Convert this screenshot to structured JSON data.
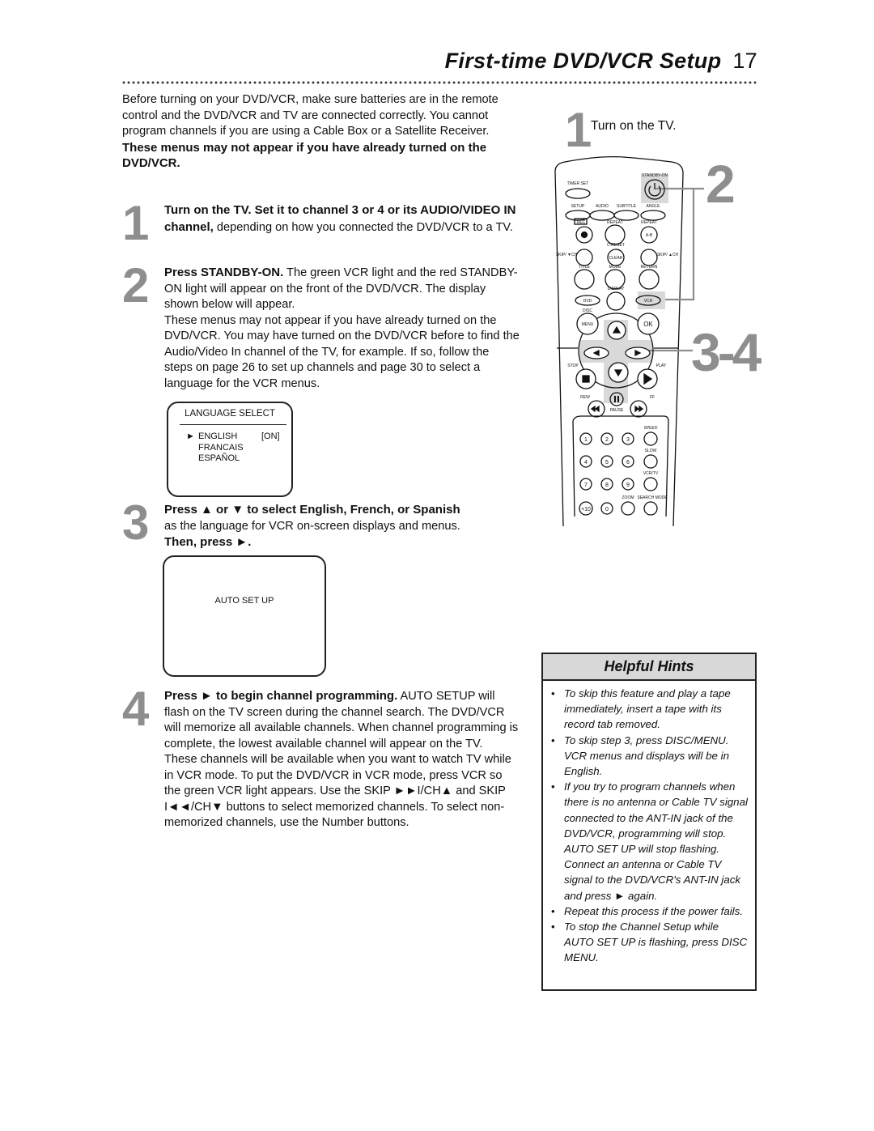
{
  "header": {
    "title": "First-time DVD/VCR Setup",
    "page_number": "17"
  },
  "intro": {
    "text": "Before turning on your DVD/VCR, make sure batteries are in the remote control and the DVD/VCR and TV are connected correctly. You cannot program channels if you are using a Cable Box or a Satellite Receiver.",
    "note": "These menus may not appear if you have already turned on the DVD/VCR."
  },
  "steps": [
    {
      "number": "1",
      "bold": "Turn on the TV. Set it to channel 3 or 4 or its AUDIO/VIDEO IN channel,",
      "text": " depending on how you connected the DVD/VCR to a TV."
    },
    {
      "number": "2",
      "bold": "Press STANDBY-ON.",
      "text": " The green VCR light and the red STANDBY-ON light will appear on the front of the DVD/VCR. The display shown below will appear.",
      "extra": "These menus may not appear if you have already turned on the DVD/VCR. You may have turned on the DVD/VCR before to find the Audio/Video In channel of the TV, for example. If so, follow the steps on page 26 to set up channels and page 30 to select a language for the VCR menus."
    },
    {
      "number": "3",
      "bold": "Press ▲ or ▼ to select English, French, or Spanish",
      "text": "as the language for VCR on-screen displays and menus.",
      "bold2": "Then, press ►."
    },
    {
      "number": "4",
      "bold": "Press ► to begin channel programming.",
      "text": " AUTO SETUP will flash on the TV screen during the channel search. The DVD/VCR will memorize all available channels. When channel programming is complete, the lowest available channel will appear on the TV.",
      "extra": "These channels will be available when you want to watch TV while in VCR mode. To put the DVD/VCR in VCR mode, press VCR so the green VCR light appears. Use the SKIP ►►I/CH▲ and SKIP I◄◄/CH▼ buttons to select memorized channels. To select non-memorized channels, use the Number buttons."
    }
  ],
  "language_screen": {
    "title": "LANGUAGE SELECT",
    "cursor": "►",
    "items": [
      "ENGLISH",
      "FRANCAIS",
      "ESPAÑOL"
    ],
    "selected_status": "[ON]"
  },
  "auto_screen": {
    "label": "AUTO SET UP"
  },
  "remote": {
    "step1_number": "1",
    "step1_label": "Turn on the TV.",
    "callout_2": "2",
    "callout_34": "3-4",
    "labels": {
      "standby": "STANDBY-ON",
      "timer_set": "TIMER SET",
      "setup": "SETUP",
      "audio": "AUDIO",
      "subtitle": "SUBTITLE",
      "angle": "ANGLE",
      "rec": "REC",
      "repeat": "REPEAT",
      "repeat_ab": "REPEAT",
      "ab": "A-B",
      "c_reset": "C-RESET",
      "clear": "CLEAR",
      "skip_left": "SKIP/ ▼CH",
      "skip_right": "SKIP/ ▲CH",
      "title": "TITLE",
      "mode": "MODE",
      "return": "RETURN",
      "display": "DISPLAY",
      "dvd": "DVD",
      "vcr": "VCR",
      "disc": "DISC",
      "menu": "MENU",
      "ok": "OK",
      "stop": "STOP",
      "play": "PLAY",
      "rew": "REW",
      "ff": "FF",
      "pause": "PAUSE",
      "speed": "SPEED",
      "slow": "SLOW",
      "vcr_tv": "VCR/TV",
      "zoom": "ZOOM",
      "search_mode": "SEARCH MODE"
    },
    "numbers": [
      "1",
      "2",
      "3",
      "4",
      "5",
      "6",
      "7",
      "8",
      "9",
      "+10",
      "0"
    ]
  },
  "hints": {
    "title": "Helpful Hints",
    "items": [
      "To skip this feature and play a tape immediately, insert a tape with its record tab removed.",
      "To skip step 3, press DISC/MENU. VCR menus and displays will be in English.",
      "If you try to program channels when there is no antenna or Cable TV signal connected to the ANT-IN jack of the DVD/VCR, programming will stop. AUTO SET UP will stop flashing. Connect an antenna or Cable TV signal to the DVD/VCR's ANT-IN jack and press ► again.",
      "Repeat this process if the power fails.",
      "To stop the Channel Setup while AUTO SET UP is flashing, press DISC MENU."
    ]
  }
}
